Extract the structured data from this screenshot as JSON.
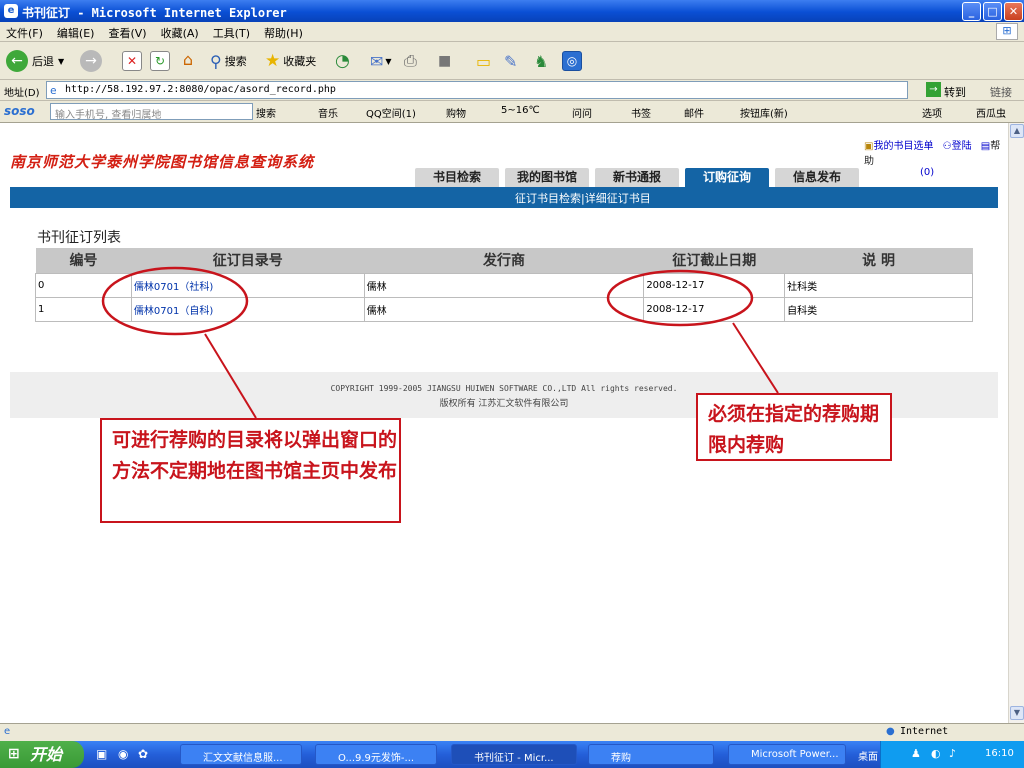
{
  "window": {
    "title": "书刊征订 - Microsoft Internet Explorer",
    "min_label": "_",
    "max_label": "□",
    "close_label": "✕"
  },
  "menu": [
    "文件(F)",
    "编辑(E)",
    "查看(V)",
    "收藏(A)",
    "工具(T)",
    "帮助(H)"
  ],
  "toolbar": {
    "back_label": "后退",
    "search_label": "搜索",
    "favorites_label": "收藏夹"
  },
  "address": {
    "label": "地址(D)",
    "url": "http://58.192.97.2:8080/opac/asord_record.php",
    "go_label": "转到",
    "links_label": "链接"
  },
  "soso": {
    "logo": "soso",
    "placeholder": "输入手机号, 查看归属地",
    "search_label": "搜索",
    "music": "音乐",
    "qzone": "QQ空间(1)",
    "shopping": "购物",
    "weather": "5~16℃",
    "ask": "问问",
    "bookmarks": "书签",
    "mail": "邮件",
    "lexicon": "按钮库(新)",
    "options": "选项",
    "watermelon": "西瓜虫"
  },
  "page": {
    "site_title": "南京师范大学泰州学院图书馆信息查询系统",
    "top_links": {
      "booklist": "我的书目选单",
      "booklist_count": "(0)",
      "login": "登陆",
      "help": "帮助"
    },
    "tabs": [
      "书目检索",
      "我的图书馆",
      "新书通报",
      "订购征询",
      "信息发布"
    ],
    "active_tab": 3,
    "subnav": {
      "search": "征订书目检索",
      "sep": "|",
      "detail": "详细征订书目"
    },
    "list_title": "书刊征订列表",
    "columns": [
      "编号",
      "征订目录号",
      "发行商",
      "征订截止日期",
      "说 明"
    ],
    "rows": [
      {
        "id": "0",
        "catalog": "儒林0701（社科)",
        "publisher": "儒林",
        "deadline": "2008-12-17",
        "note": "社科类"
      },
      {
        "id": "1",
        "catalog": "儒林0701（自科)",
        "publisher": "儒林",
        "deadline": "2008-12-17",
        "note": "自科类"
      }
    ],
    "footer": {
      "copyright": "COPYRIGHT 1999-2005 JIANGSU HUIWEN SOFTWARE CO.,LTD All rights reserved.",
      "owner": "版权所有 江苏汇文软件有限公司"
    }
  },
  "callouts": {
    "left": "可进行荐购的目录将以弹出窗口的方法不定期地在图书馆主页中发布",
    "right": "必须在指定的荐购期限内荐购"
  },
  "status": {
    "zone": "Internet"
  },
  "taskbar": {
    "start": "开始",
    "tasks": [
      "汇文文献信息服...",
      "O...9.9元发饰-...",
      "书刊征订 - Micr...",
      "荐购",
      "Microsoft Power..."
    ],
    "desktop": "桌面",
    "time": "16:10"
  },
  "colors": {
    "accent_blue": "#1464a5",
    "callout_red": "#c8141c",
    "title_red": "#d31e12"
  }
}
